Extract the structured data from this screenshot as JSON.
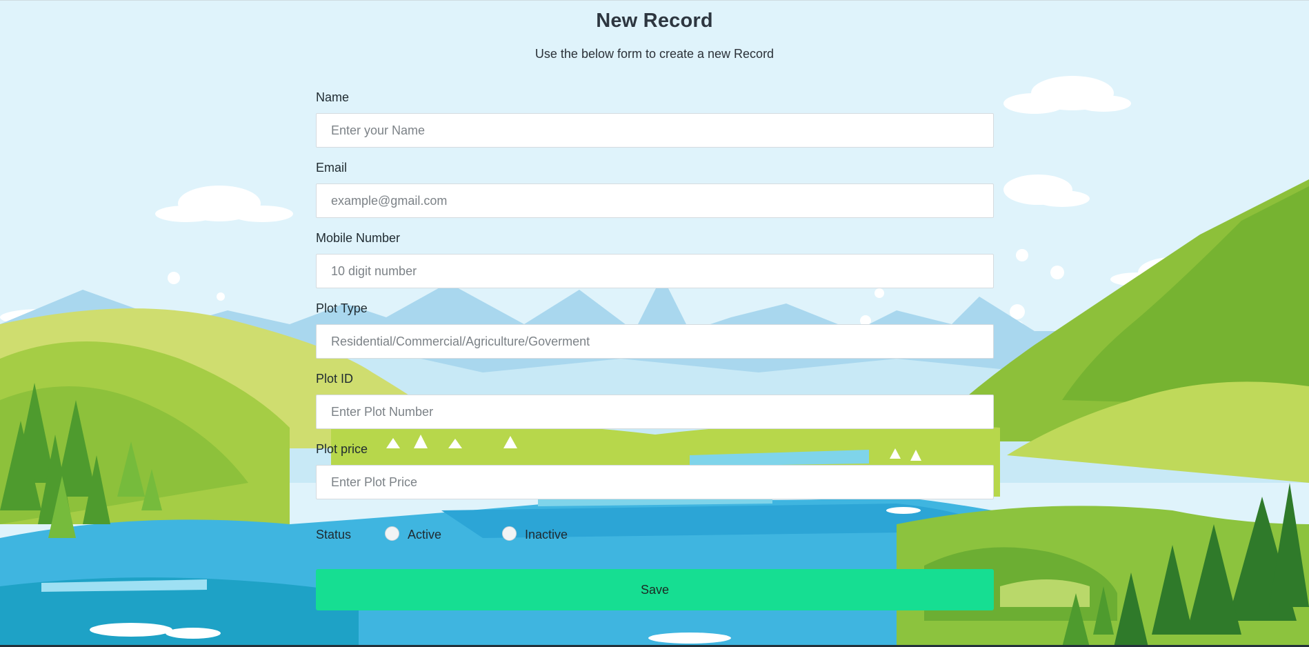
{
  "header": {
    "title": "New Record",
    "subtitle": "Use the below form to create a new Record"
  },
  "form": {
    "fields": [
      {
        "label": "Name",
        "placeholder": "Enter your Name",
        "value": ""
      },
      {
        "label": "Email",
        "placeholder": "example@gmail.com",
        "value": ""
      },
      {
        "label": "Mobile Number",
        "placeholder": "10 digit number",
        "value": ""
      },
      {
        "label": "Plot Type",
        "placeholder": "Residential/Commercial/Agriculture/Goverment",
        "value": ""
      },
      {
        "label": "Plot ID",
        "placeholder": "Enter Plot Number",
        "value": ""
      },
      {
        "label": "Plot price",
        "placeholder": "Enter Plot Price",
        "value": ""
      }
    ],
    "status": {
      "label": "Status",
      "options": [
        "Active",
        "Inactive"
      ],
      "selected": null
    },
    "save_label": "Save"
  },
  "colors": {
    "accent": "#16de92",
    "sky": "#dff3fb",
    "text": "#1f2a30"
  }
}
